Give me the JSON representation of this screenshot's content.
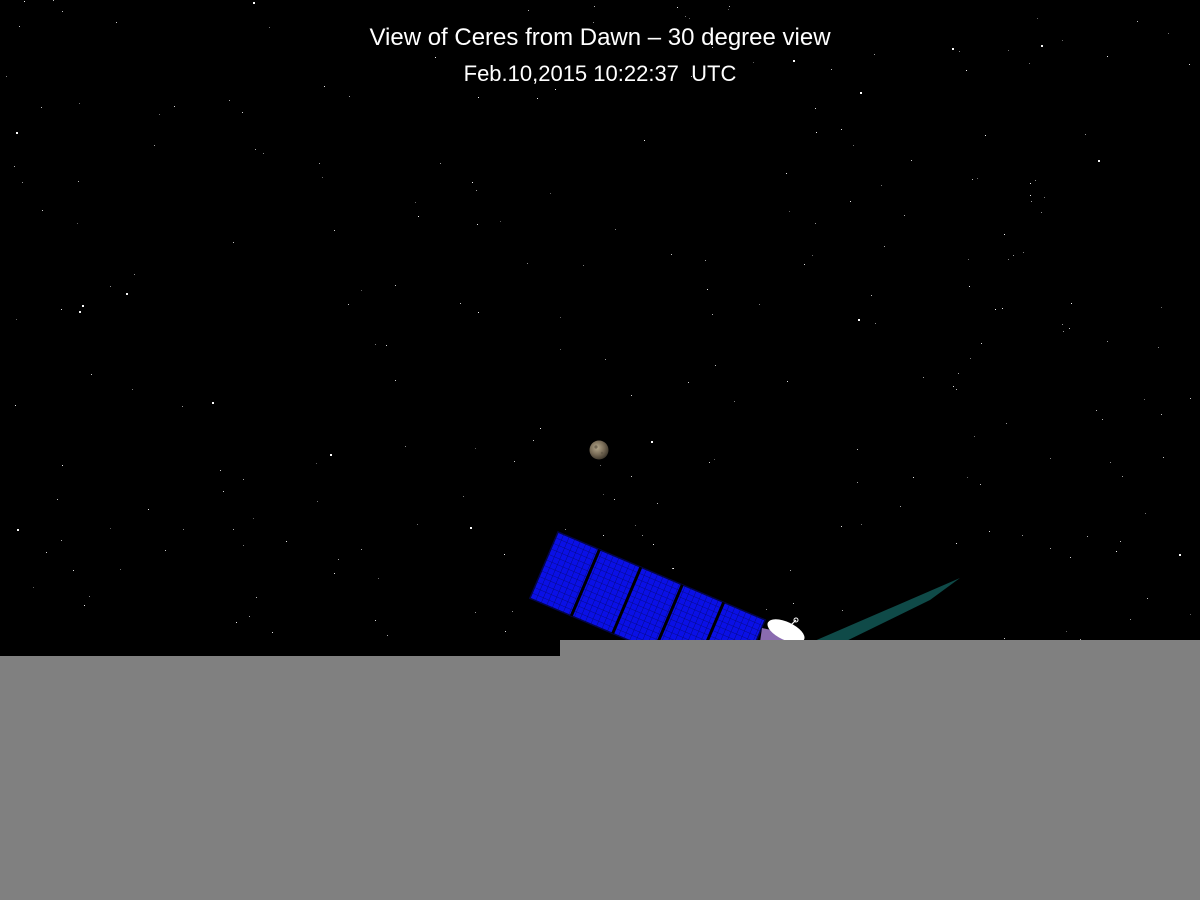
{
  "header": {
    "title": "View of Ceres from Dawn – 30 degree view",
    "timestamp": "Feb.10,2015 10:22:37  UTC"
  },
  "colors": {
    "sky": "#000000",
    "text": "#ffffff",
    "solar_panel": "#0a10e6",
    "spacecraft_body": "#8a6bb0",
    "antenna": "#ffffff",
    "ion_beam": "#0f4a48",
    "ceres": "#7a6d58",
    "occluder": "#808080"
  }
}
